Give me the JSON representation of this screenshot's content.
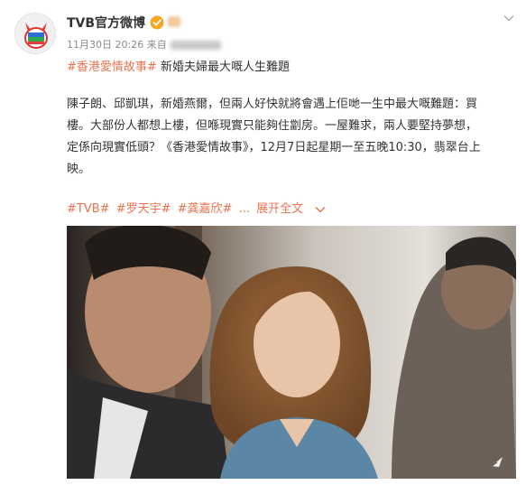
{
  "post": {
    "author": "TVB官方微博",
    "timestamp": "11月30日 20:26",
    "source_prefix": "来自",
    "title_hashtag": "#香港愛情故事#",
    "title_text": "新婚夫婦最大嘅人生難題",
    "body_lines": [
      "陳子朗、邱凱琪，新婚燕爾，但兩人好快就將會遇上佢哋一生中最大嘅難題：買",
      "樓。大部份人都想上樓，但喺現實只能夠住劏房。一屋難求，兩人要堅持夢想，",
      "定係向現實低頭？《香港愛情故事》，12月7日起星期一至五晚10:30，翡翠台上",
      "映。"
    ],
    "tags": [
      "#TVB#",
      "#罗天宇#",
      "#龚嘉欣#",
      "..."
    ],
    "expand_label": "展开全文"
  },
  "colors": {
    "link": "#eb7350",
    "text": "#333333",
    "meta": "#8a8a8a",
    "verified": "#f5a623"
  },
  "icons": {
    "avatar": "tvb-logo-icon",
    "verified": "verified-badge-icon",
    "menu": "chevron-down-icon",
    "expand": "chevron-down-icon",
    "media": "video-icon"
  }
}
